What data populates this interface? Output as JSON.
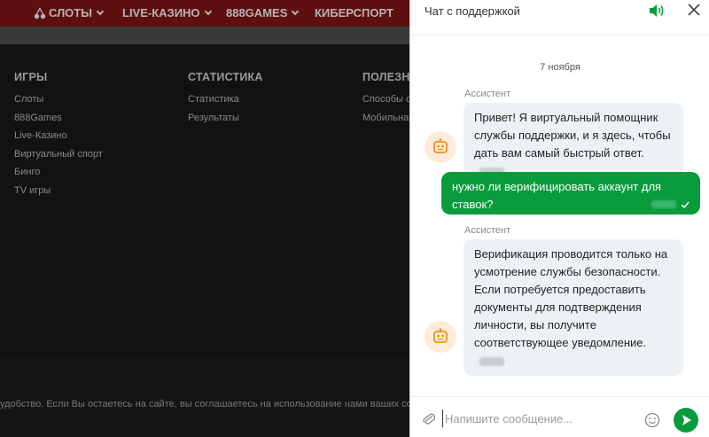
{
  "site": {
    "nav": [
      {
        "label": "СЛОТЫ",
        "has_dropdown": true
      },
      {
        "label": "LIVE-КАЗИНО",
        "has_dropdown": true
      },
      {
        "label": "888GAMES",
        "has_dropdown": true
      },
      {
        "label": "КИБЕРСПОРТ",
        "has_dropdown": false
      }
    ],
    "footer": {
      "games": {
        "title": "ИГРЫ",
        "links": [
          "Слоты",
          "888Games",
          "Live-Казино",
          "Виртуальный спорт",
          "Бинго",
          "TV игры"
        ]
      },
      "stats": {
        "title": "СТАТИСТИКА",
        "links": [
          "Статистика",
          "Результаты"
        ]
      },
      "useful": {
        "title": "ПОЛЕЗНО",
        "links": [
          "Способы о",
          "Мобильна"
        ]
      }
    },
    "cookie_notice": "удобство. Если Вы остаетесь на сайте, вы соглашаетесь на использование нами ваших cookie"
  },
  "chat": {
    "title": "Чат с поддержкой",
    "date": "7 ноября",
    "messages": [
      {
        "from": "assistant",
        "sender": "Ассистент",
        "text": "Привет! Я виртуальный помощник службы поддержки, и я здесь, чтобы дать вам самый быстрый ответ."
      },
      {
        "from": "user",
        "text": "нужно ли верифицировать аккаунт для ставок?"
      },
      {
        "from": "assistant",
        "sender": "Ассистент",
        "text": "Верификация проводится только на усмотрение службы безопасности. Если потребуется предоставить документы для подтверждения личности, вы получите соответствующее уведомление."
      }
    ],
    "input_placeholder": "Напишите сообщение..."
  },
  "colors": {
    "accent_green": "#0a9b3d",
    "nav_red_dimmed": "#5e0f0f",
    "assistant_bubble": "#eef1f4",
    "avatar_bg": "#fcebd8",
    "avatar_icon": "#e8951e"
  },
  "icons": [
    "cherry-icon",
    "chevron-down-icon",
    "speaker-icon",
    "close-icon",
    "robot-icon",
    "check-icon",
    "paperclip-icon",
    "emoji-icon",
    "send-icon"
  ]
}
